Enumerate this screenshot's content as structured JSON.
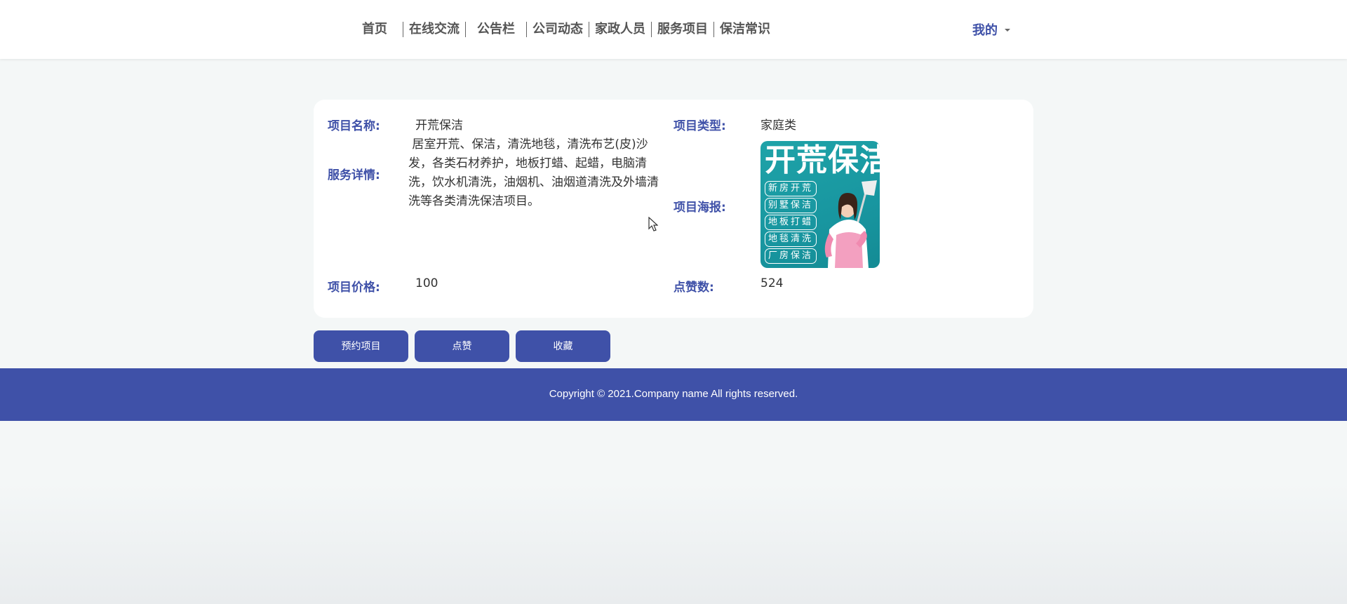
{
  "nav": {
    "items": [
      "首页",
      "在线交流",
      "公告栏",
      "公司动态",
      "家政人员",
      "服务项目",
      "保洁常识"
    ],
    "user_menu_label": "我的"
  },
  "detail": {
    "name_label": "项目名称:",
    "name_value": "开荒保洁",
    "type_label": "项目类型:",
    "type_value": "家庭类",
    "desc_label": "服务详情:",
    "desc_value": "居室开荒、保洁，清洗地毯，清洗布艺(皮)沙发，各类石材养护，地板打蜡、起蜡，电脑清洗，饮水机清洗，油烟机、油烟道清洗及外墙清洗等各类清洗保洁项目。",
    "poster_label": "项目海报:",
    "price_label": "项目价格:",
    "price_value": "100",
    "likes_label": "点赞数:",
    "likes_value": "524"
  },
  "poster": {
    "title": "开荒保洁",
    "tags": [
      "新房开荒",
      "别墅保洁",
      "地板打蜡",
      "地毯清洗",
      "厂房保洁"
    ]
  },
  "actions": {
    "book_label": "预约项目",
    "like_label": "点赞",
    "favorite_label": "收藏"
  },
  "footer": {
    "copyright": "Copyright © 2021.Company name All rights reserved."
  },
  "colors": {
    "accent": "#3f51a8",
    "poster_teal": "#1896a0"
  }
}
